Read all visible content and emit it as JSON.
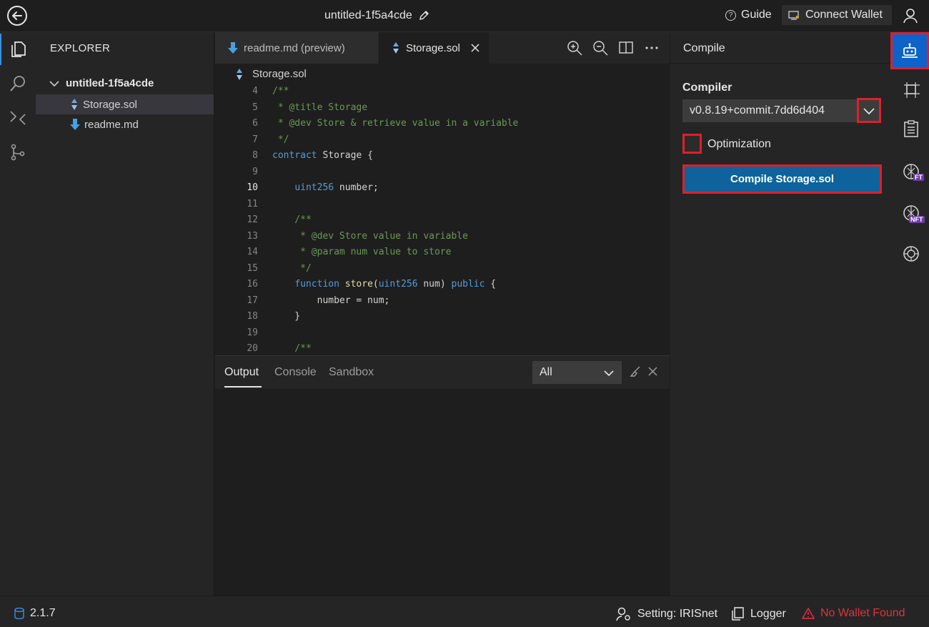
{
  "titlebar": {
    "project_name": "untitled-1f5a4cde",
    "guide_label": "Guide",
    "connect_wallet_label": "Connect Wallet"
  },
  "explorer": {
    "title": "EXPLORER",
    "root": "untitled-1f5a4cde",
    "files": [
      "Storage.sol",
      "readme.md"
    ]
  },
  "editor": {
    "tabs": [
      {
        "label": "readme.md (preview)"
      },
      {
        "label": "Storage.sol"
      }
    ],
    "breadcrumb": "Storage.sol",
    "lines": [
      {
        "n": "4",
        "text": "/**"
      },
      {
        "n": "5",
        "text": " * @title Storage"
      },
      {
        "n": "6",
        "text": " * @dev Store & retrieve value in a variable"
      },
      {
        "n": "7",
        "text": " */"
      },
      {
        "n": "8",
        "text": "contract Storage {"
      },
      {
        "n": "9",
        "text": ""
      },
      {
        "n": "10",
        "text": "    uint256 number;"
      },
      {
        "n": "11",
        "text": ""
      },
      {
        "n": "12",
        "text": "    /**"
      },
      {
        "n": "13",
        "text": "     * @dev Store value in variable"
      },
      {
        "n": "14",
        "text": "     * @param num value to store"
      },
      {
        "n": "15",
        "text": "     */"
      },
      {
        "n": "16",
        "text": "    function store(uint256 num) public {"
      },
      {
        "n": "17",
        "text": "        number = num;"
      },
      {
        "n": "18",
        "text": "    }"
      },
      {
        "n": "19",
        "text": ""
      },
      {
        "n": "20",
        "text": "    /**"
      }
    ]
  },
  "panel": {
    "tabs": [
      "Output",
      "Console",
      "Sandbox"
    ],
    "filter_value": "All"
  },
  "compile": {
    "header": "Compile",
    "compiler_label": "Compiler",
    "compiler_version": "v0.8.19+commit.7dd6d404",
    "optimization_label": "Optimization",
    "compile_button": "Compile Storage.sol"
  },
  "right_badges": {
    "ft": "FT",
    "nft": "NFT"
  },
  "statusbar": {
    "version": "2.1.7",
    "setting": "Setting: IRISnet",
    "logger": "Logger",
    "wallet_status": "No Wallet Found"
  },
  "colors": {
    "accent": "#0e639c",
    "highlight_border": "#e01e2b",
    "warning": "#e0323c"
  }
}
